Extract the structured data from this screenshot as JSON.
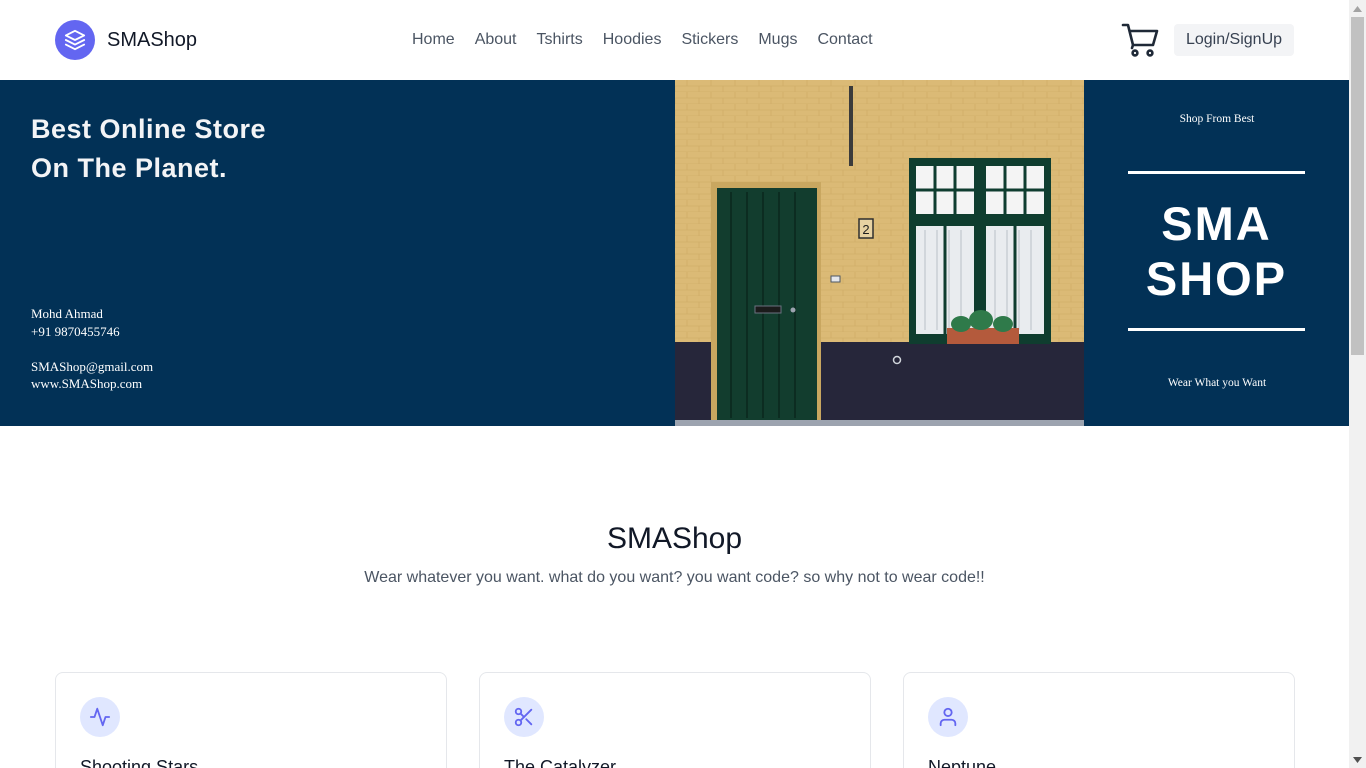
{
  "navbar": {
    "brand_name": "SMAShop",
    "brand_icon": "stack-layers-icon",
    "links": [
      "Home",
      "About",
      "Tshirts",
      "Hoodies",
      "Stickers",
      "Mugs",
      "Contact"
    ],
    "cart_icon": "cart-icon",
    "login_label": "Login/SignUp"
  },
  "hero": {
    "headline": "Best Online Store On The Planet.",
    "contact_name": "Mohd Ahmad",
    "contact_phone": "+91 9870455746",
    "contact_email": "SMAShop@gmail.com",
    "contact_web": "www.SMAShop.com",
    "tagline_top": "Shop From Best",
    "big_line1": "SMA",
    "big_line2": "SHOP",
    "tagline_bottom": "Wear What you Want",
    "door_number": "2"
  },
  "intro": {
    "title": "SMAShop",
    "subtitle": "Wear whatever you want. what do you want? you want code? so why not to wear code!!"
  },
  "cards": [
    {
      "title": "Shooting Stars",
      "icon": "activity-pulse-icon"
    },
    {
      "title": "The Catalyzer",
      "icon": "scissors-icon"
    },
    {
      "title": "Neptune",
      "icon": "user-icon"
    }
  ],
  "colors": {
    "accent": "#6366f1",
    "accent_light": "#e0e7ff",
    "hero_bg": "#023156",
    "text_dark": "#111827",
    "text_muted": "#4b5563"
  }
}
